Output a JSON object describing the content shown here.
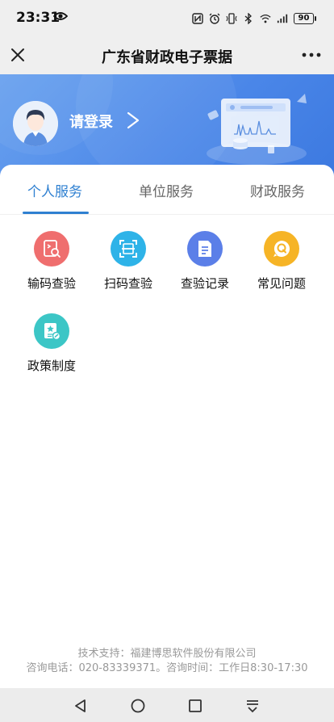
{
  "status_bar": {
    "time": "23:31",
    "battery": "90",
    "icons": [
      "eye-icon",
      "nfc-icon",
      "alarm-icon",
      "vibrate-icon",
      "bluetooth-icon",
      "wifi-icon",
      "signal-icon",
      "battery-icon"
    ]
  },
  "title_bar": {
    "title": "广东省财政电子票据",
    "close_icon": "close-icon",
    "more_icon": "more-icon"
  },
  "banner": {
    "login_text": "请登录",
    "arrow": ">",
    "colors": {
      "start": "#6aa2ef",
      "end": "#3c79e0"
    }
  },
  "tabs": [
    {
      "label": "个人服务",
      "active": true
    },
    {
      "label": "单位服务",
      "active": false
    },
    {
      "label": "财政服务",
      "active": false
    }
  ],
  "services": [
    {
      "label": "输码查验",
      "icon": "code-search-icon",
      "color": "#ef6e6e"
    },
    {
      "label": "扫码查验",
      "icon": "scan-icon",
      "color": "#2eb3e8"
    },
    {
      "label": "查验记录",
      "icon": "document-list-icon",
      "color": "#5b7fe8"
    },
    {
      "label": "常见问题",
      "icon": "question-icon",
      "color": "#f6b426"
    },
    {
      "label": "政策制度",
      "icon": "policy-icon",
      "color": "#3cc6c6"
    }
  ],
  "footer": {
    "line1": "技术支持：福建博思软件股份有限公司",
    "line2": "咨询电话：020-83339371。咨询时间：工作日8:30-17:30"
  },
  "accent_color": "#2f80d1"
}
